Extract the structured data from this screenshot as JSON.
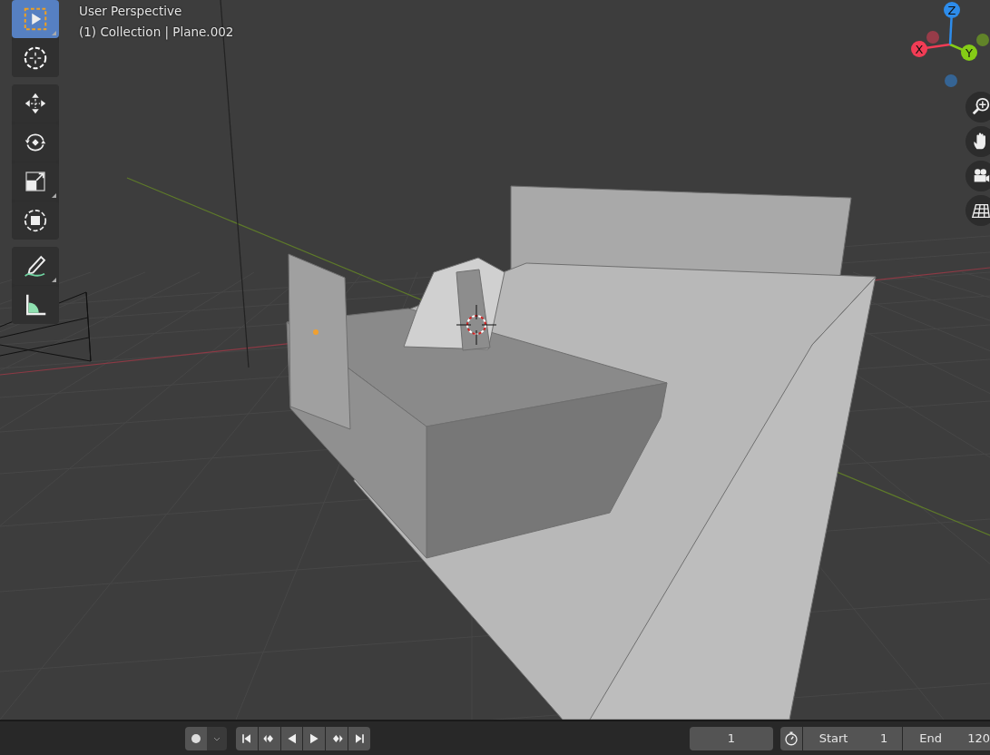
{
  "viewport": {
    "view_name": "User Perspective",
    "object_info": "(1) Collection | Plane.002",
    "tool_groups": [
      {
        "tools": [
          {
            "kind": "select",
            "selected": true,
            "submenu": true
          },
          {
            "kind": "cursor",
            "selected": false,
            "submenu": false
          }
        ]
      },
      {
        "tools": [
          {
            "kind": "move",
            "selected": false,
            "submenu": false
          },
          {
            "kind": "rotate",
            "selected": false,
            "submenu": false
          },
          {
            "kind": "scale",
            "selected": false,
            "submenu": true
          },
          {
            "kind": "transform",
            "selected": false,
            "submenu": false
          }
        ]
      },
      {
        "tools": [
          {
            "kind": "annotate",
            "selected": false,
            "submenu": true
          },
          {
            "kind": "measure",
            "selected": false,
            "submenu": false
          }
        ]
      }
    ],
    "axes": [
      {
        "label": "X",
        "color": "#f23c55"
      },
      {
        "label": "Y",
        "color": "#85cc16"
      },
      {
        "label": "Z",
        "color": "#2d8ceb"
      }
    ],
    "nav_buttons": [
      {
        "kind": "zoom"
      },
      {
        "kind": "pan"
      },
      {
        "kind": "camera"
      },
      {
        "kind": "ortho"
      }
    ]
  },
  "timeline": {
    "recording": false,
    "playback": [
      {
        "kind": "jump_start"
      },
      {
        "kind": "prev_key"
      },
      {
        "kind": "play_reverse"
      },
      {
        "kind": "play"
      },
      {
        "kind": "next_key"
      },
      {
        "kind": "jump_end"
      }
    ],
    "current_frame": "1",
    "start": {
      "label": "Start",
      "value": "1"
    },
    "end": {
      "label": "End",
      "value": "120"
    }
  }
}
